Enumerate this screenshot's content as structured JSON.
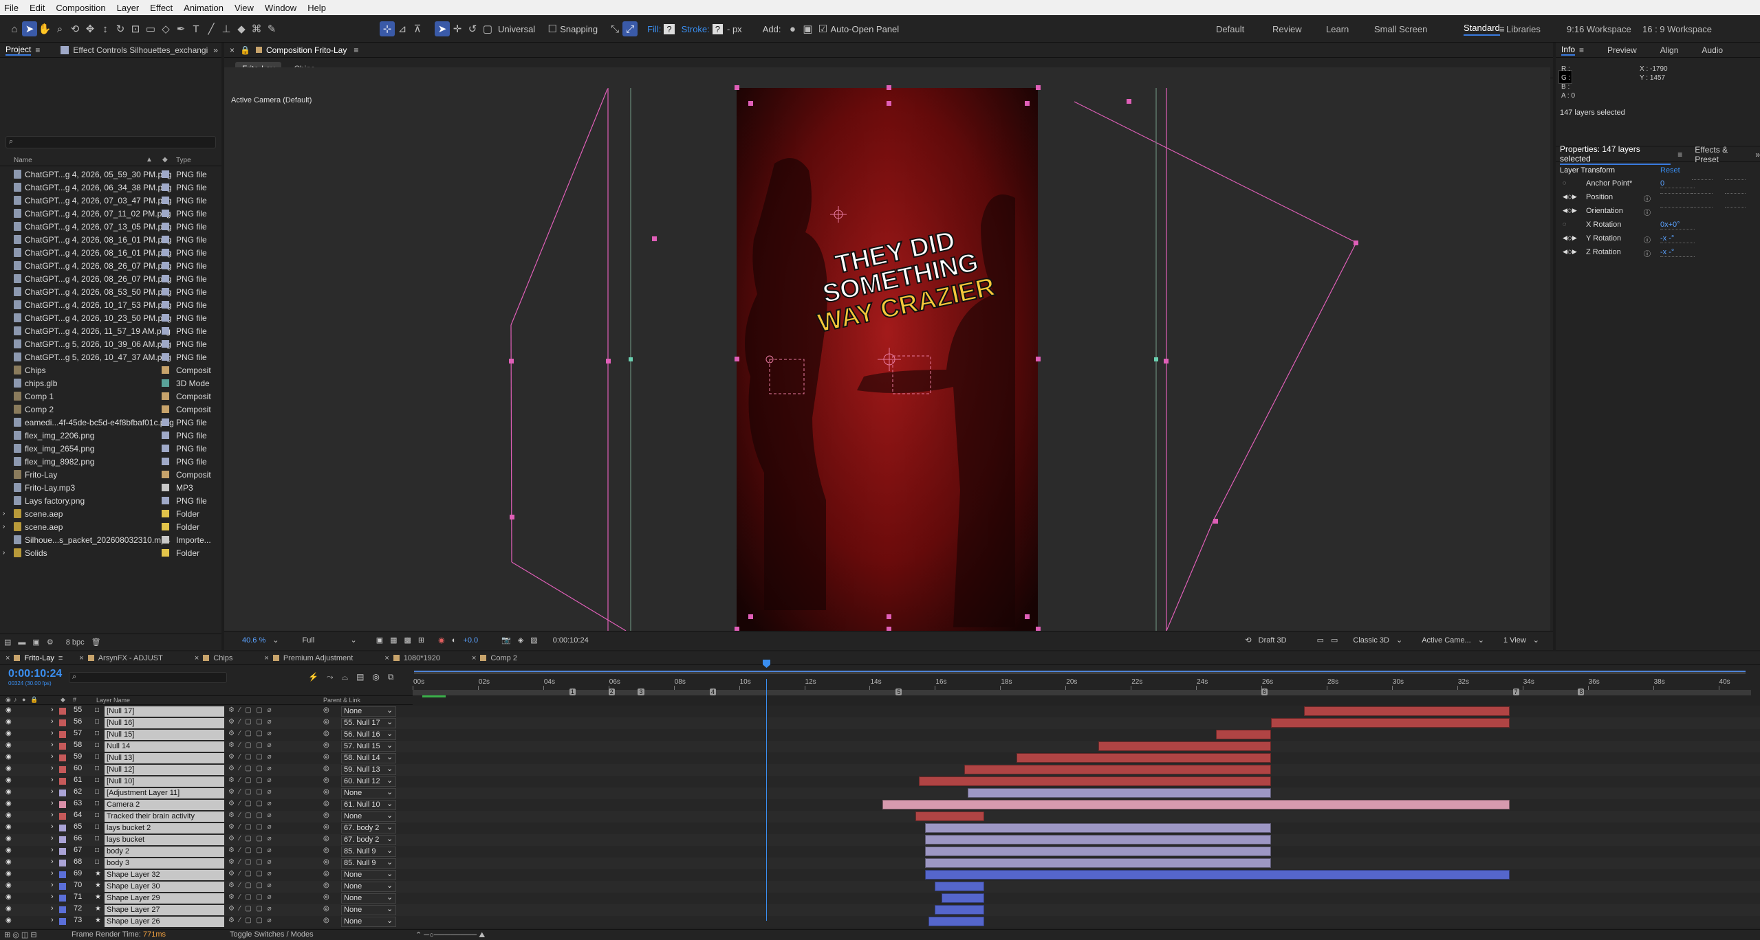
{
  "menu": [
    "File",
    "Edit",
    "Composition",
    "Layer",
    "Effect",
    "Animation",
    "View",
    "Window",
    "Help"
  ],
  "toolbar": {
    "universal": "Universal",
    "snapping": "Snapping",
    "fill": "Fill:",
    "fill_q": "?",
    "stroke": "Stroke:",
    "stroke_q": "?",
    "px": "- px",
    "add": "Add:",
    "auto_open": "Auto-Open Panel"
  },
  "workspaces": [
    "Default",
    "Review",
    "Learn",
    "Small Screen",
    "Standard",
    "Libraries",
    "9:16 Workspace",
    "16 : 9 Workspace"
  ],
  "project": {
    "tab": "Project",
    "effect_tab": "Effect Controls Silhouettes_exchangi",
    "col_name": "Name",
    "col_type": "Type",
    "bpc": "8 bpc",
    "items": [
      {
        "name": "ChatGPT...g 4, 2026, 05_59_30 PM.png",
        "type": "PNG file",
        "color": "#9fa9c8",
        "kind": "file"
      },
      {
        "name": "ChatGPT...g 4, 2026, 06_34_38 PM.png",
        "type": "PNG file",
        "color": "#9fa9c8",
        "kind": "file"
      },
      {
        "name": "ChatGPT...g 4, 2026, 07_03_47 PM.png",
        "type": "PNG file",
        "color": "#9fa9c8",
        "kind": "file"
      },
      {
        "name": "ChatGPT...g 4, 2026, 07_11_02 PM.png",
        "type": "PNG file",
        "color": "#9fa9c8",
        "kind": "file"
      },
      {
        "name": "ChatGPT...g 4, 2026, 07_13_05 PM.png",
        "type": "PNG file",
        "color": "#9fa9c8",
        "kind": "file"
      },
      {
        "name": "ChatGPT...g 4, 2026, 08_16_01 PM.png",
        "type": "PNG file",
        "color": "#9fa9c8",
        "kind": "file"
      },
      {
        "name": "ChatGPT...g 4, 2026, 08_16_01 PM.png",
        "type": "PNG file",
        "color": "#9fa9c8",
        "kind": "file"
      },
      {
        "name": "ChatGPT...g 4, 2026, 08_26_07 PM.png",
        "type": "PNG file",
        "color": "#9fa9c8",
        "kind": "file"
      },
      {
        "name": "ChatGPT...g 4, 2026, 08_26_07 PM.png",
        "type": "PNG file",
        "color": "#9fa9c8",
        "kind": "file"
      },
      {
        "name": "ChatGPT...g 4, 2026, 08_53_50 PM.png",
        "type": "PNG file",
        "color": "#9fa9c8",
        "kind": "file"
      },
      {
        "name": "ChatGPT...g 4, 2026, 10_17_53 PM.png",
        "type": "PNG file",
        "color": "#9fa9c8",
        "kind": "file"
      },
      {
        "name": "ChatGPT...g 4, 2026, 10_23_50 PM.png",
        "type": "PNG file",
        "color": "#9fa9c8",
        "kind": "file"
      },
      {
        "name": "ChatGPT...g 4, 2026, 11_57_19 AM.png",
        "type": "PNG file",
        "color": "#9fa9c8",
        "kind": "file"
      },
      {
        "name": "ChatGPT...g 5, 2026, 10_39_06 AM.png",
        "type": "PNG file",
        "color": "#9fa9c8",
        "kind": "file"
      },
      {
        "name": "ChatGPT...g 5, 2026, 10_47_37 AM.png",
        "type": "PNG file",
        "color": "#9fa9c8",
        "kind": "file"
      },
      {
        "name": "Chips",
        "type": "Composit",
        "color": "#c7a36b",
        "kind": "comp"
      },
      {
        "name": "chips.glb",
        "type": "3D Mode",
        "color": "#5aa39a",
        "kind": "file"
      },
      {
        "name": "Comp 1",
        "type": "Composit",
        "color": "#c7a36b",
        "kind": "comp"
      },
      {
        "name": "Comp 2",
        "type": "Composit",
        "color": "#c7a36b",
        "kind": "comp"
      },
      {
        "name": "eamedi...4f-45de-bc5d-e4f8bfbaf01c.png",
        "type": "PNG file",
        "color": "#9fa9c8",
        "kind": "file"
      },
      {
        "name": "flex_img_2206.png",
        "type": "PNG file",
        "color": "#9fa9c8",
        "kind": "file"
      },
      {
        "name": "flex_img_2654.png",
        "type": "PNG file",
        "color": "#9fa9c8",
        "kind": "file"
      },
      {
        "name": "flex_img_8982.png",
        "type": "PNG file",
        "color": "#9fa9c8",
        "kind": "file"
      },
      {
        "name": "Frito-Lay",
        "type": "Composit",
        "color": "#c7a36b",
        "kind": "comp"
      },
      {
        "name": "Frito-Lay.mp3",
        "type": "MP3",
        "color": "#c7c7c7",
        "kind": "file"
      },
      {
        "name": "Lays factory.png",
        "type": "PNG file",
        "color": "#9fa9c8",
        "kind": "file"
      },
      {
        "name": "scene.aep",
        "type": "Folder",
        "color": "#e2c44a",
        "kind": "folder"
      },
      {
        "name": "scene.aep",
        "type": "Folder",
        "color": "#e2c44a",
        "kind": "folder"
      },
      {
        "name": "Silhoue...s_packet_202608032310.mp4",
        "type": "Importe...",
        "color": "#c7c7c7",
        "kind": "file"
      },
      {
        "name": "Solids",
        "type": "Folder",
        "color": "#e2c44a",
        "kind": "folder"
      }
    ]
  },
  "composition": {
    "tab": "Composition Frito-Lay",
    "crumb1": "Frito-Lay",
    "crumb2": "Chips",
    "camera": "Active Camera (Default)",
    "zoom": "40.6",
    "zoom_unit": "%",
    "res": "Full",
    "timecode": "0:00:10:24",
    "exposure": "+0.0",
    "draft": "Draft 3D",
    "renderer": "Classic 3D",
    "cam_menu": "Active Came...",
    "view_menu": "1 View",
    "caption": [
      "THEY DID",
      "SOMETHING",
      "WAY CRAZIER"
    ]
  },
  "info": {
    "tabs": [
      "Info",
      "Preview",
      "Align",
      "Audio"
    ],
    "r": "R :",
    "g": "G :",
    "b": "B :",
    "a": "A : 0",
    "x": "X : -1790",
    "y": "Y : 1457",
    "selected": "147 layers selected"
  },
  "properties": {
    "title": "Properties: 147 layers selected",
    "effects": "Effects & Preset",
    "section": "Layer Transform",
    "reset": "Reset",
    "rows": [
      {
        "label": "Anchor Point*",
        "val": "0"
      },
      {
        "label": "Position",
        "val": ""
      },
      {
        "label": "Orientation",
        "val": ""
      },
      {
        "label": "X Rotation",
        "val": "0x+0°"
      },
      {
        "label": "Y Rotation",
        "val": "-x -°"
      },
      {
        "label": "Z Rotation",
        "val": "-x -°"
      }
    ]
  },
  "timeline": {
    "tabs": [
      {
        "name": "Frito-Lay",
        "color": "#c7a36b"
      },
      {
        "name": "ArsynFX - ADJUST",
        "color": "#c7a36b"
      },
      {
        "name": "Chips",
        "color": "#c7a36b"
      },
      {
        "name": "Premium Adjustment",
        "color": "#c7a36b"
      },
      {
        "name": "1080*1920",
        "color": "#c7a36b"
      },
      {
        "name": "Comp 2",
        "color": "#c7a36b"
      }
    ],
    "timecode": "0:00:10:24",
    "fps": "00324 (30.00 fps)",
    "col_layer": "Layer Name",
    "col_parent": "Parent & Link",
    "ruler": [
      "00s",
      "02s",
      "04s",
      "06s",
      "08s",
      "10s",
      "12s",
      "14s",
      "16s",
      "18s",
      "20s",
      "22s",
      "24s",
      "26s",
      "28s",
      "30s",
      "32s",
      "34s",
      "36s",
      "38s",
      "40s"
    ],
    "markers": [
      "1",
      "2",
      "3",
      "4",
      "5",
      "6",
      "7",
      "8"
    ],
    "playhead_s": 10.83,
    "duration_s": 41,
    "footer_render": "Frame Render Time:",
    "footer_ms": "771ms",
    "footer_toggle": "Toggle Switches / Modes",
    "layers": [
      {
        "num": "55",
        "name": "[Null 17]",
        "parent": "None",
        "lbl": "#c65a5a",
        "bar": [
          27.3,
          33.6
        ],
        "barc": "#b04444"
      },
      {
        "num": "56",
        "name": "[Null 16]",
        "parent": "55. Null 17",
        "lbl": "#c65a5a",
        "bar": [
          26.3,
          33.6
        ],
        "barc": "#b04444"
      },
      {
        "num": "57",
        "name": "[Null 15]",
        "parent": "56. Null 16",
        "lbl": "#c65a5a",
        "bar": [
          24.6,
          26.3
        ],
        "barc": "#b04444"
      },
      {
        "num": "58",
        "name": "Null 14",
        "parent": "57. Null 15",
        "lbl": "#c65a5a",
        "bar": [
          21.0,
          26.3
        ],
        "barc": "#b04444"
      },
      {
        "num": "59",
        "name": "[Null 13]",
        "parent": "58. Null 14",
        "lbl": "#c65a5a",
        "bar": [
          18.5,
          26.3
        ],
        "barc": "#b04444"
      },
      {
        "num": "60",
        "name": "[Null 12]",
        "parent": "59. Null 13",
        "lbl": "#c65a5a",
        "bar": [
          16.9,
          26.3
        ],
        "barc": "#b04444"
      },
      {
        "num": "61",
        "name": "[Null 10]",
        "parent": "60. Null 12",
        "lbl": "#c65a5a",
        "bar": [
          15.5,
          26.3
        ],
        "barc": "#b04444"
      },
      {
        "num": "62",
        "name": "[Adjustment Layer 11]",
        "parent": "None",
        "lbl": "#aaa3d6",
        "bar": [
          17.0,
          26.3
        ],
        "barc": "#9d97c4"
      },
      {
        "num": "63",
        "name": "Camera 2",
        "parent": "61. Null 10",
        "lbl": "#d98fa8",
        "bar": [
          14.4,
          33.6
        ],
        "barc": "#d79aae"
      },
      {
        "num": "64",
        "name": "Tracked their brain activity",
        "parent": "None",
        "lbl": "#c65a5a",
        "bar": [
          15.4,
          17.5
        ],
        "barc": "#b04444"
      },
      {
        "num": "65",
        "name": "lays bucket 2",
        "parent": "67. body 2",
        "lbl": "#aaa3d6",
        "bar": [
          15.7,
          26.3
        ],
        "barc": "#9d97c4"
      },
      {
        "num": "66",
        "name": "lays bucket",
        "parent": "67. body 2",
        "lbl": "#aaa3d6",
        "bar": [
          15.7,
          26.3
        ],
        "barc": "#9d97c4"
      },
      {
        "num": "67",
        "name": "body 2",
        "parent": "85. Null 9",
        "lbl": "#aaa3d6",
        "bar": [
          15.7,
          26.3
        ],
        "barc": "#9d97c4"
      },
      {
        "num": "68",
        "name": "body 3",
        "parent": "85. Null 9",
        "lbl": "#aaa3d6",
        "bar": [
          15.7,
          26.3
        ],
        "barc": "#9d97c4"
      },
      {
        "num": "69",
        "name": "Shape Layer 32",
        "parent": "None",
        "lbl": "#5b6fd8",
        "bar": [
          15.7,
          33.6
        ],
        "barc": "#5566cc"
      },
      {
        "num": "70",
        "name": "Shape Layer 30",
        "parent": "None",
        "lbl": "#5b6fd8",
        "bar": [
          16.0,
          17.5
        ],
        "barc": "#5566cc"
      },
      {
        "num": "71",
        "name": "Shape Layer 29",
        "parent": "None",
        "lbl": "#5b6fd8",
        "bar": [
          16.2,
          17.5
        ],
        "barc": "#5566cc"
      },
      {
        "num": "72",
        "name": "Shape Layer 27",
        "parent": "None",
        "lbl": "#5b6fd8",
        "bar": [
          16.0,
          17.5
        ],
        "barc": "#5566cc"
      },
      {
        "num": "73",
        "name": "Shape Layer 26",
        "parent": "None",
        "lbl": "#5b6fd8",
        "bar": [
          15.8,
          17.5
        ],
        "barc": "#5566cc"
      }
    ]
  }
}
